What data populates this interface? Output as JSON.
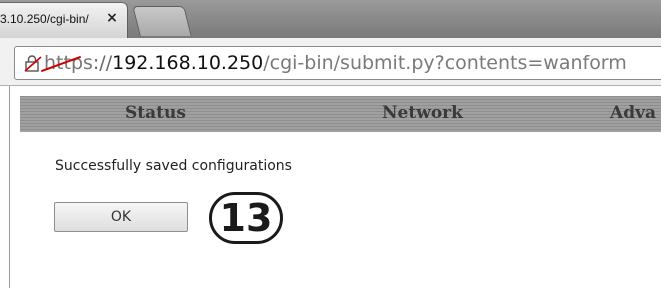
{
  "browser": {
    "tab": {
      "title": "3.10.250/cgi-bin/",
      "close_glyph": "×"
    },
    "address": {
      "scheme": "https",
      "separator": "://",
      "host": "192.168.10.250",
      "path": "/cgi-bin/submit.py?contents=wanform",
      "lock_icon": "broken-lock-icon",
      "scheme_color": "#cc0000"
    }
  },
  "nav": {
    "items": [
      {
        "label": "Status"
      },
      {
        "label": "Network"
      },
      {
        "label": "Adva"
      }
    ]
  },
  "main": {
    "message": "Successfully saved configurations",
    "ok_label": "OK"
  },
  "annotation": {
    "callout_number": "13"
  }
}
